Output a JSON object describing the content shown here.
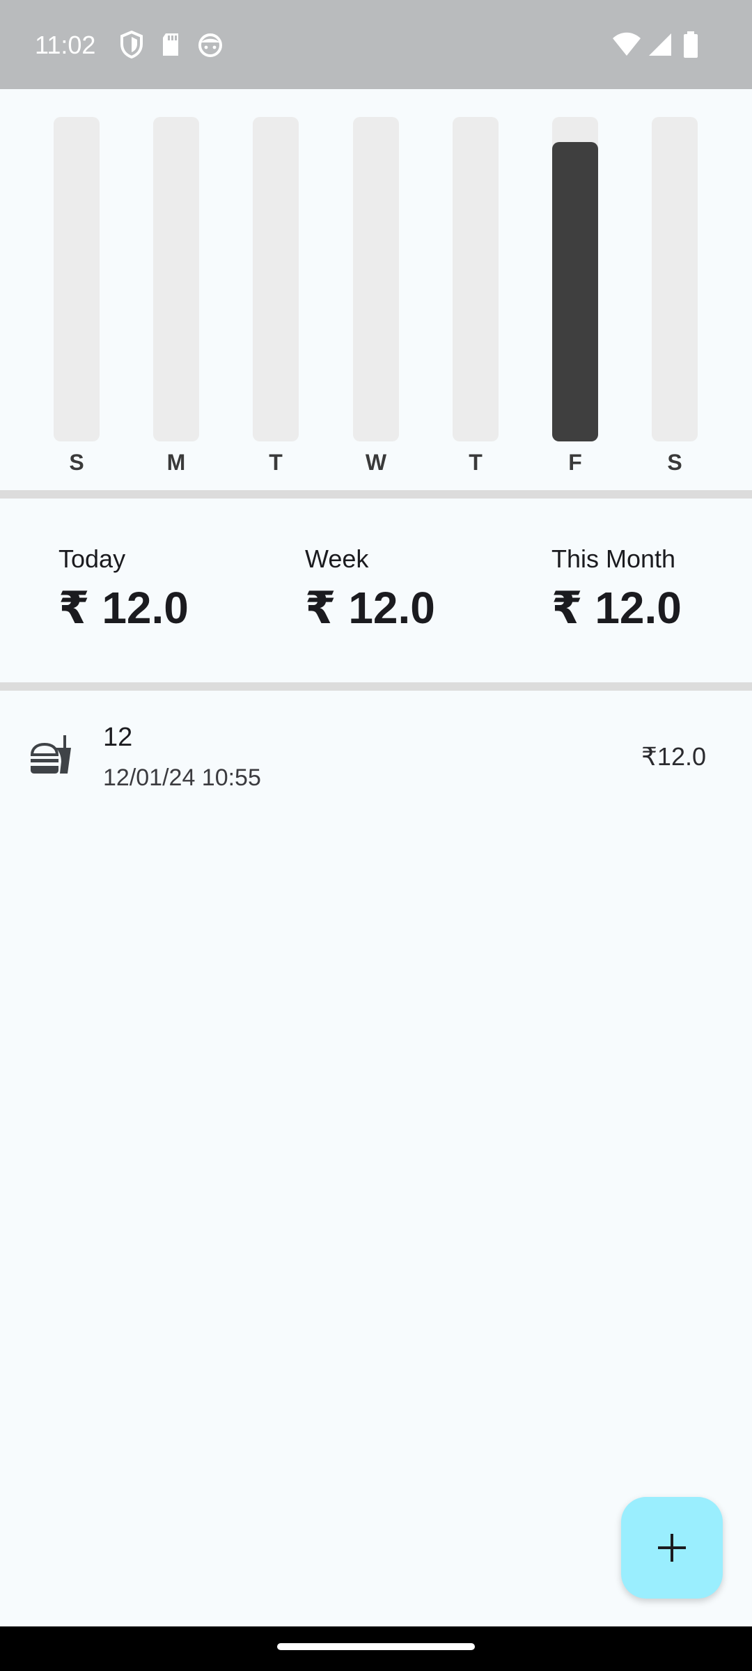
{
  "status_bar": {
    "time": "11:02",
    "left_icons": [
      "shield-icon",
      "sd-card-icon",
      "face-icon"
    ],
    "right_icons": [
      "wifi-icon",
      "signal-icon",
      "battery-icon"
    ]
  },
  "chart_data": {
    "type": "bar",
    "categories": [
      "S",
      "M",
      "T",
      "W",
      "T",
      "F",
      "S"
    ],
    "values": [
      0,
      0,
      0,
      0,
      0,
      12.0,
      0
    ],
    "ylim": [
      0,
      13
    ],
    "colors": {
      "fill": "#3f3f3f",
      "track": "#ececec"
    }
  },
  "summary": {
    "today": {
      "label": "Today",
      "value": "₹ 12.0"
    },
    "week": {
      "label": "Week",
      "value": "₹ 12.0"
    },
    "month": {
      "label": "This Month",
      "value": "₹ 12.0"
    }
  },
  "transactions": [
    {
      "icon": "fastfood-icon",
      "title": "12",
      "datetime": "12/01/24 10:55",
      "amount": "₹12.0"
    }
  ],
  "fab": {
    "icon": "add-icon",
    "color": "#9aeefe"
  }
}
